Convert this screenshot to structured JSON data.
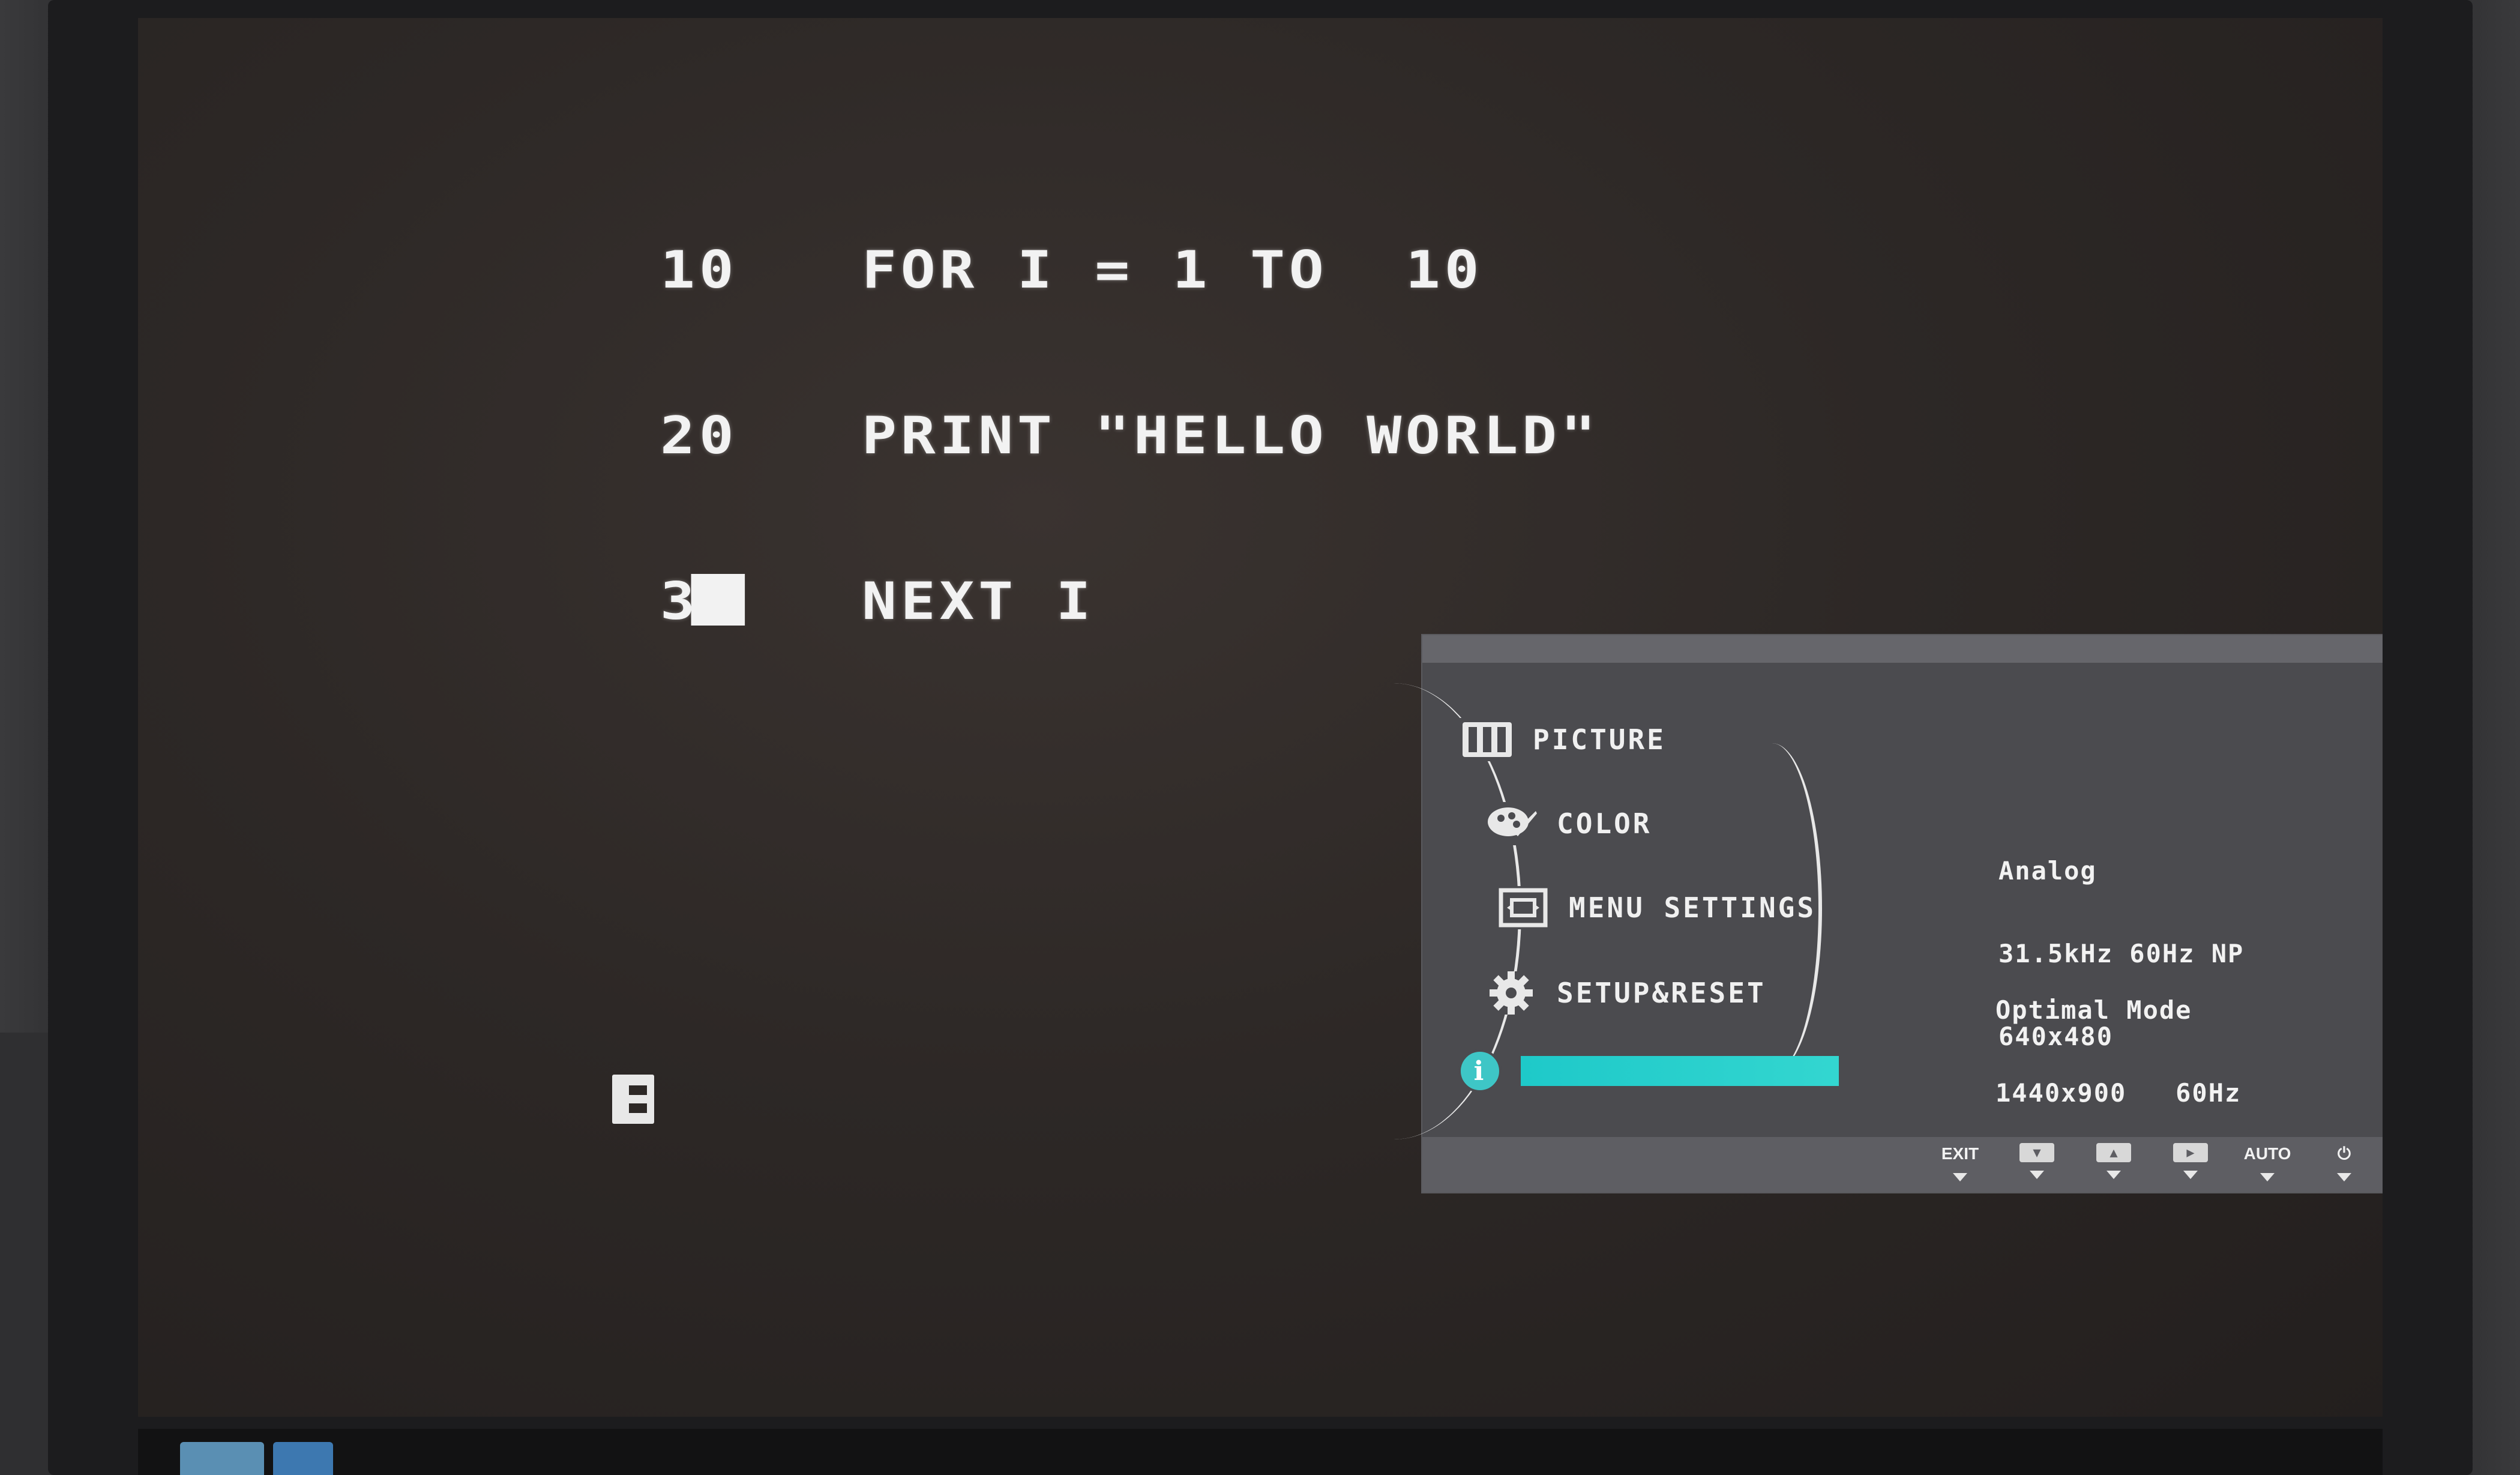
{
  "program": {
    "lines": [
      {
        "num": "10",
        "code": "FOR I = 1 TO  10"
      },
      {
        "num": "20",
        "code": "PRINT \"HELLO WORLD\""
      },
      {
        "num": "30",
        "code": "NEXT I"
      }
    ]
  },
  "osd": {
    "menu": [
      {
        "icon": "picture-icon",
        "label": "PICTURE"
      },
      {
        "icon": "color-palette-icon",
        "label": "COLOR"
      },
      {
        "icon": "menu-settings-icon",
        "label": "MENU SETTINGS"
      },
      {
        "icon": "gear-icon",
        "label": "SETUP&RESET"
      },
      {
        "icon": "info-icon",
        "label": ""
      }
    ],
    "signal": {
      "type": "Analog",
      "timing": "31.5kHz 60Hz NP",
      "resolution": "640x480"
    },
    "optimal": {
      "title": "Optimal Mode",
      "value": "1440x900   60Hz"
    },
    "keys": [
      {
        "label": "EXIT",
        "icon": "exit-key"
      },
      {
        "label": "",
        "icon": "down-key"
      },
      {
        "label": "",
        "icon": "up-key"
      },
      {
        "label": "",
        "icon": "enter-key"
      },
      {
        "label": "AUTO",
        "icon": "auto-key"
      },
      {
        "label": "",
        "icon": "power-key"
      }
    ],
    "accent": "#1ec9c9"
  }
}
